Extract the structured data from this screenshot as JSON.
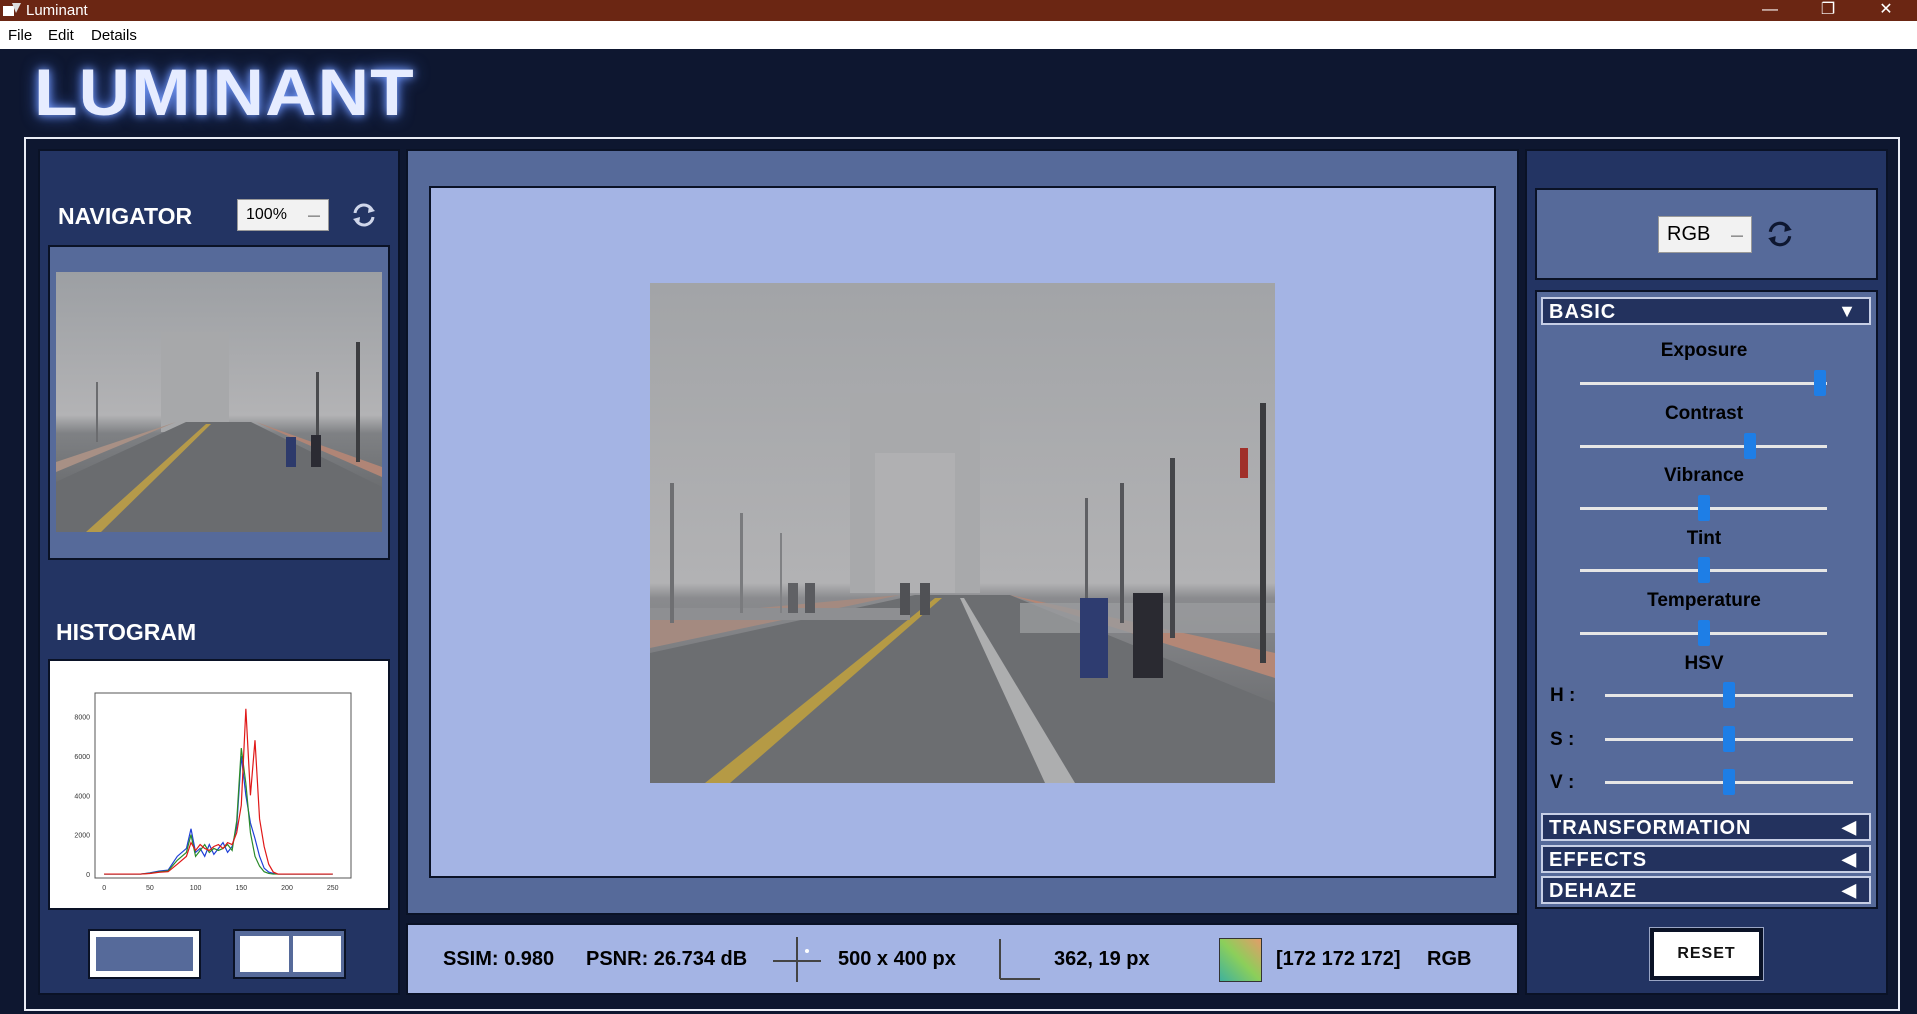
{
  "window": {
    "title": "Luminant",
    "controls": [
      "—",
      "❐",
      "✕"
    ]
  },
  "menu": [
    "File",
    "Edit",
    "Details"
  ],
  "logo": "LUMINANT",
  "navigator": {
    "title": "NAVIGATOR",
    "zoom": "100%"
  },
  "histogram": {
    "title": "HISTOGRAM",
    "y_ticks": [
      "8000",
      "6000",
      "4000",
      "2000",
      "0"
    ],
    "x_ticks": [
      "0",
      "50",
      "100",
      "150",
      "200",
      "250"
    ]
  },
  "chart_data": {
    "type": "line",
    "x": [
      0,
      20,
      40,
      50,
      60,
      70,
      80,
      90,
      95,
      100,
      105,
      110,
      115,
      120,
      125,
      130,
      135,
      140,
      145,
      150,
      155,
      160,
      165,
      170,
      175,
      180,
      185,
      190,
      200,
      220,
      250
    ],
    "series": [
      {
        "name": "",
        "color": "#1f3fd8",
        "values": [
          0,
          0,
          0,
          60,
          150,
          200,
          900,
          1300,
          2300,
          1100,
          1300,
          900,
          1500,
          1000,
          1300,
          1600,
          1100,
          1400,
          2400,
          6000,
          4000,
          2600,
          1800,
          900,
          300,
          100,
          30,
          0,
          0,
          0,
          0
        ]
      },
      {
        "name": "",
        "color": "#2a8a2a",
        "values": [
          0,
          0,
          0,
          40,
          110,
          160,
          700,
          1100,
          2000,
          900,
          1200,
          1500,
          1100,
          1300,
          1200,
          1300,
          1500,
          1200,
          2700,
          6400,
          4600,
          2100,
          900,
          400,
          120,
          30,
          0,
          0,
          0,
          0,
          0
        ]
      },
      {
        "name": "",
        "color": "#e01818",
        "values": [
          0,
          0,
          0,
          30,
          90,
          120,
          500,
          900,
          1600,
          1200,
          1500,
          1300,
          1200,
          1400,
          1500,
          1300,
          1600,
          1500,
          2100,
          3500,
          8400,
          4000,
          6800,
          2800,
          1400,
          500,
          100,
          0,
          0,
          0,
          0
        ]
      }
    ],
    "xlim": [
      -10,
      270
    ],
    "ylim": [
      -200,
      9200
    ]
  },
  "rgb_dropdown": "RGB",
  "sections": {
    "basic": "BASIC",
    "transformation": "TRANSFORMATION",
    "effects": "EFFECTS",
    "dehaze": "DEHAZE"
  },
  "sliders": [
    {
      "label": "Exposure",
      "value": 0.97
    },
    {
      "label": "Contrast",
      "value": 0.69
    },
    {
      "label": "Vibrance",
      "value": 0.5
    },
    {
      "label": "Tint",
      "value": 0.5
    },
    {
      "label": "Temperature",
      "value": 0.5
    }
  ],
  "hsv": {
    "title": "HSV",
    "channels": [
      {
        "label": "H :",
        "value": 0.5
      },
      {
        "label": "S :",
        "value": 0.5
      },
      {
        "label": "V :",
        "value": 0.5
      }
    ]
  },
  "reset_label": "RESET",
  "status": {
    "ssim": "SSIM: 0.980",
    "psnr": "PSNR: 26.734 dB",
    "size": "500 x 400 px",
    "coords": "362, 19 px",
    "pixel": "[172 172 172]",
    "mode": "RGB"
  }
}
